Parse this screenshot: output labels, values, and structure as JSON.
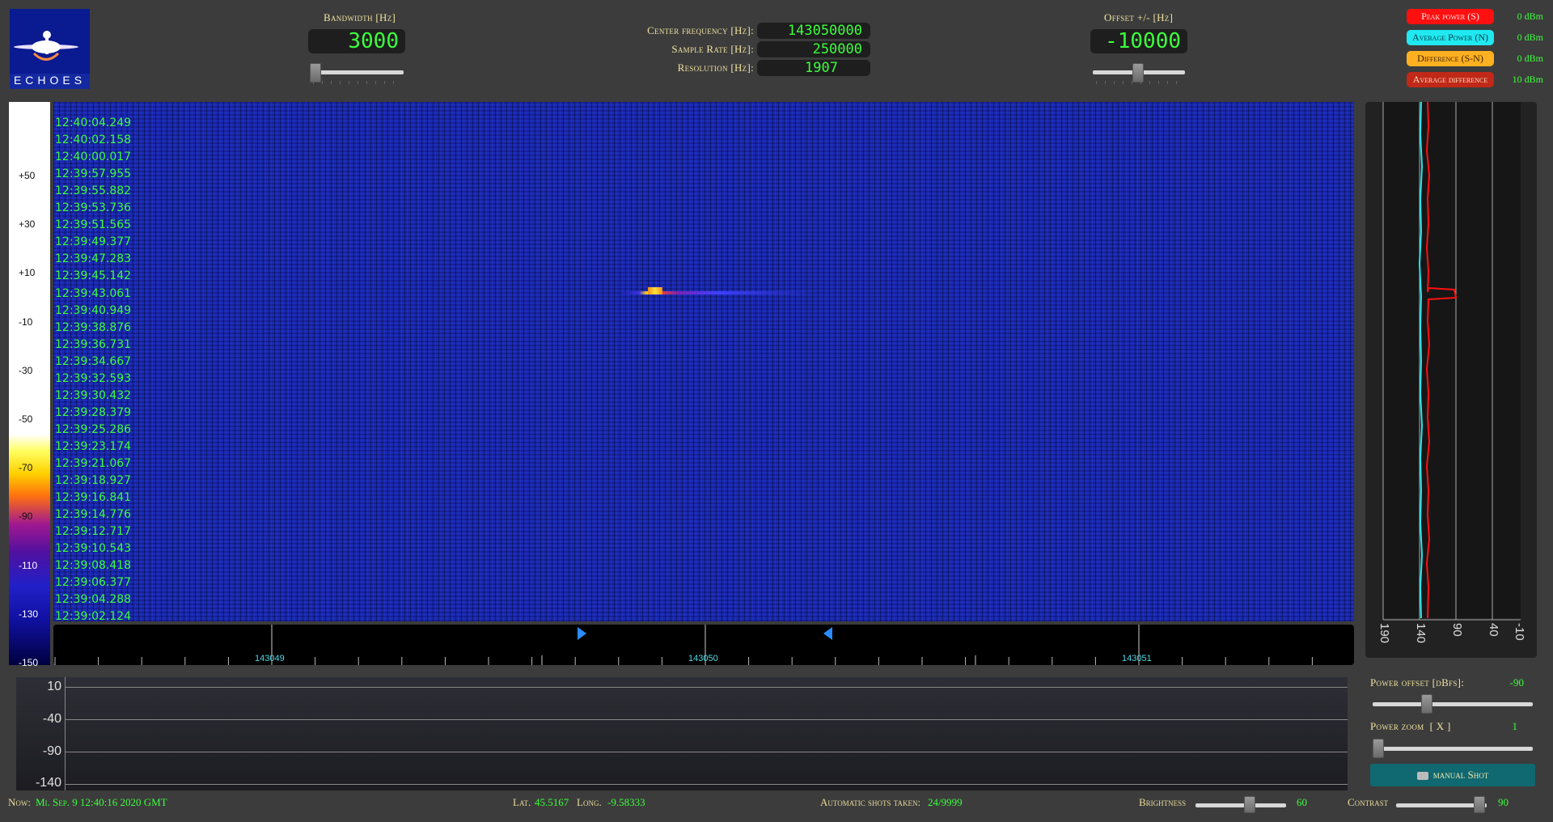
{
  "logo": {
    "text": "ECHOES"
  },
  "bandwidth": {
    "label": "Bandwidth [Hz]",
    "value": "3000",
    "slider_pct": 2
  },
  "center": {
    "freq_label": "Center frequency [Hz]:",
    "freq_value": "143050000",
    "rate_label": "Sample Rate [Hz]:",
    "rate_value": "250000",
    "res_label": "Resolution [Hz]:",
    "res_value": "1907"
  },
  "offset": {
    "label": "Offset +/- [Hz]",
    "value": "-10000",
    "slider_pct": 47
  },
  "legend": [
    {
      "label": "Peak power (S)",
      "value": "0 dBm",
      "color": "#ff1010",
      "text": "#ffe0e0"
    },
    {
      "label": "Average Power (N)",
      "value": "0 dBm",
      "color": "#20e8f0",
      "text": "#003040"
    },
    {
      "label": "Difference (S-N)",
      "value": "0 dBm",
      "color": "#ffb020",
      "text": "#402000"
    },
    {
      "label": "Average difference",
      "value": "10 dBm",
      "color": "#c02818",
      "text": "#ffe0c0"
    }
  ],
  "colorbar_labels": [
    "+50",
    "+30",
    "+10",
    "-10",
    "-30",
    "-50",
    "-70",
    "-90",
    "-110",
    "-130",
    "-150"
  ],
  "timestamps": [
    "12:40:04.249",
    "12:40:02.158",
    "12:40:00.017",
    "12:39:57.955",
    "12:39:55.882",
    "12:39:53.736",
    "12:39:51.565",
    "12:39:49.377",
    "12:39:47.283",
    "12:39:45.142",
    "12:39:43.061",
    "12:39:40.949",
    "12:39:38.876",
    "12:39:36.731",
    "12:39:34.667",
    "12:39:32.593",
    "12:39:30.432",
    "12:39:28.379",
    "12:39:25.286",
    "12:39:23.174",
    "12:39:21.067",
    "12:39:18.927",
    "12:39:16.841",
    "12:39:14.776",
    "12:39:12.717",
    "12:39:10.543",
    "12:39:08.418",
    "12:39:06.377",
    "12:39:04.288",
    "12:39:02.124"
  ],
  "freq_axis": {
    "labels": [
      "143049",
      "143050",
      "143051"
    ]
  },
  "side_scale": {
    "labels": [
      "190",
      "140",
      "90",
      "40",
      "-10"
    ]
  },
  "power_plot": {
    "y_labels": [
      "10",
      "-40",
      "-90",
      "-140"
    ]
  },
  "controls": {
    "power_offset_label": "Power offset [dBfs]:",
    "power_offset_value": "-90",
    "power_offset_pct": 31,
    "power_zoom_label": "Power zoom  [ X ]",
    "power_zoom_value": "1",
    "power_zoom_pct": 2,
    "manual_shot_label": "manual Shot"
  },
  "status": {
    "now_label": "Now:",
    "now_value": "Mi. Sep. 9 12:40:16 2020 GMT",
    "lat_label": "Lat.",
    "lat_value": "45.5167",
    "long_label": "Long.",
    "long_value": "-9.58333",
    "shots_label": "Automatic shots taken:",
    "shots_value": "24/9999",
    "brightness_label": "Brightness",
    "brightness_value": "60",
    "brightness_pct": 60,
    "contrast_label": "Contrast",
    "contrast_value": "90",
    "contrast_pct": 90
  }
}
